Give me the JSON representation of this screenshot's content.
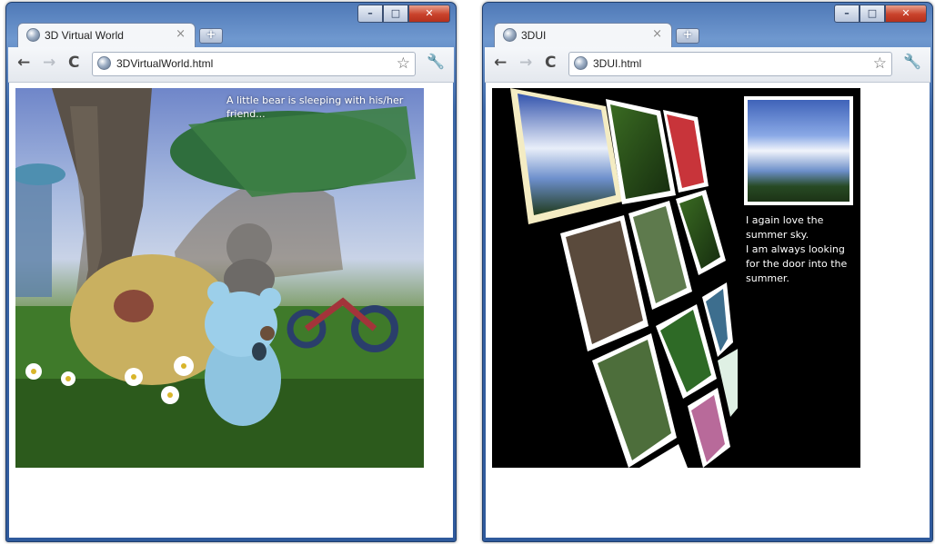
{
  "windows": [
    {
      "tab_title": "3D Virtual World",
      "url": "3DVirtualWorld.html",
      "caption": "A little bear is sleeping with his/her friend..."
    },
    {
      "tab_title": "3DUI",
      "url": "3DUI.html",
      "caption_lines": [
        "I again love the",
        "summer sky.",
        "I am always looking",
        "for the door into the",
        "summer."
      ]
    }
  ],
  "window_controls": {
    "minimize": "–",
    "maximize": "□",
    "close": "✕"
  },
  "icons": {
    "back": "back-arrow-icon",
    "forward": "forward-arrow-icon",
    "reload": "reload-icon",
    "star": "bookmark-star-icon",
    "wrench": "wrench-menu-icon",
    "newtab": "new-tab-icon"
  },
  "glyphs": {
    "tab_close": "×",
    "newtab": "+",
    "back": "←",
    "forward": "→",
    "reload": "C",
    "star": "☆",
    "wrench": "🔧"
  }
}
